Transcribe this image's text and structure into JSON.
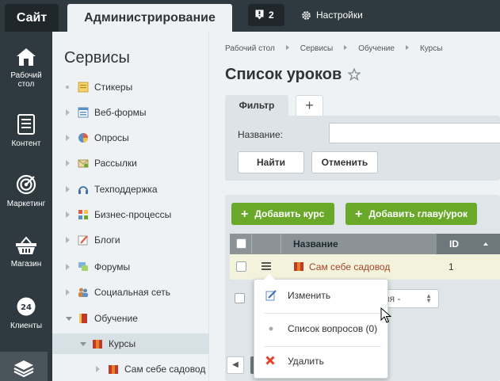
{
  "topbar": {
    "site_tab": "Сайт",
    "admin_tab": "Администрирование",
    "notifications_count": "2",
    "settings_label": "Настройки"
  },
  "left_menu": [
    {
      "label": "Рабочий стол",
      "icon": "home-icon"
    },
    {
      "label": "Контент",
      "icon": "document-icon"
    },
    {
      "label": "Маркетинг",
      "icon": "target-icon"
    },
    {
      "label": "Магазин",
      "icon": "basket-icon"
    },
    {
      "label": "Клиенты",
      "icon": "clients-24-icon"
    },
    {
      "label": "",
      "icon": "layers-icon"
    }
  ],
  "services": {
    "title": "Сервисы",
    "items": [
      {
        "label": "Стикеры",
        "expander": "bullet"
      },
      {
        "label": "Веб-формы",
        "expander": "arrow"
      },
      {
        "label": "Опросы",
        "expander": "arrow"
      },
      {
        "label": "Рассылки",
        "expander": "arrow"
      },
      {
        "label": "Техподдержка",
        "expander": "arrow"
      },
      {
        "label": "Бизнес-процессы",
        "expander": "arrow"
      },
      {
        "label": "Блоги",
        "expander": "arrow"
      },
      {
        "label": "Форумы",
        "expander": "arrow"
      },
      {
        "label": "Социальная сеть",
        "expander": "arrow"
      },
      {
        "label": "Обучение",
        "expander": "open"
      },
      {
        "label": "Курсы",
        "expander": "open",
        "active": true
      },
      {
        "label": "Сам себе садовод",
        "expander": "arrow"
      }
    ]
  },
  "breadcrumb": [
    "Рабочий стол",
    "Сервисы",
    "Обучение",
    "Курсы"
  ],
  "page": {
    "title": "Список уроков"
  },
  "filter": {
    "tab_label": "Фильтр",
    "add_tab": "+",
    "name_label": "Название:",
    "name_value": "",
    "find_button": "Найти",
    "cancel_button": "Отменить"
  },
  "toolbar": {
    "add_course": "Добавить курс",
    "add_chapter": "Добавить главу/урок"
  },
  "grid": {
    "columns": [
      "Название",
      "ID"
    ],
    "rows": [
      {
        "name": "Сам себе садовод",
        "id": "1"
      }
    ],
    "actions_select": "твия -"
  },
  "popup_menu": [
    {
      "label": "Изменить",
      "icon": "edit-icon"
    },
    {
      "label": "Список вопросов (0)",
      "icon": "bullet-icon"
    },
    {
      "label": "Удалить",
      "icon": "delete-icon"
    }
  ],
  "colors": {
    "dark_bg": "#2f3a40",
    "panel_bg": "#eef2f4",
    "green": "#6aa82a",
    "row_highlight": "#f3f3dc",
    "link_red": "#a4452c"
  }
}
